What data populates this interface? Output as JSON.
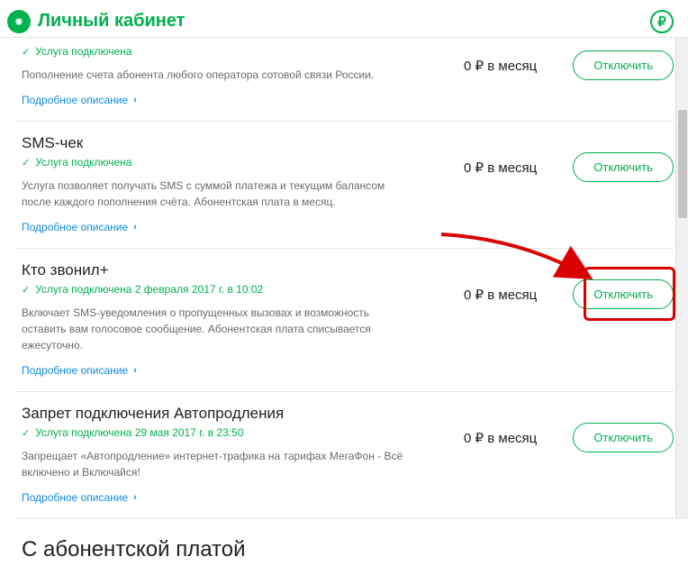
{
  "header": {
    "title": "Личный кабинет"
  },
  "services": [
    {
      "title": "",
      "status": "Услуга подключена",
      "desc": "Пополнение счета абонента любого оператора сотовой связи России.",
      "details": "Подробное описание",
      "price": "0 ₽ в месяц",
      "btn": "Отключить"
    },
    {
      "title": "SMS-чек",
      "status": "Услуга подключена",
      "desc": "Услуга позволяет получать SMS с суммой платежа и текущим балансом после каждого пополнения счёта. Абонентская плата в месяц.",
      "details": "Подробное описание",
      "price": "0 ₽ в месяц",
      "btn": "Отключить"
    },
    {
      "title": "Кто звонил+",
      "status": "Услуга подключена 2 февраля 2017 г. в 10:02",
      "desc": "Включает SMS-уведомления о пропущенных вызовах и возможность оставить вам голосовое сообщение. Абонентская плата списывается ежесуточно.",
      "details": "Подробное описание",
      "price": "0 ₽ в месяц",
      "btn": "Отключить"
    },
    {
      "title": "Запрет подключения Автопродления",
      "status": "Услуга подключена 29 мая 2017 г. в 23:50",
      "desc": "Запрещает «Автопродление» интернет-трафика на тарифах МегаФон - Всё включено и Включайся!",
      "details": "Подробное описание",
      "price": "0 ₽ в месяц",
      "btn": "Отключить"
    }
  ],
  "section": {
    "heading": "С абонентской платой"
  }
}
